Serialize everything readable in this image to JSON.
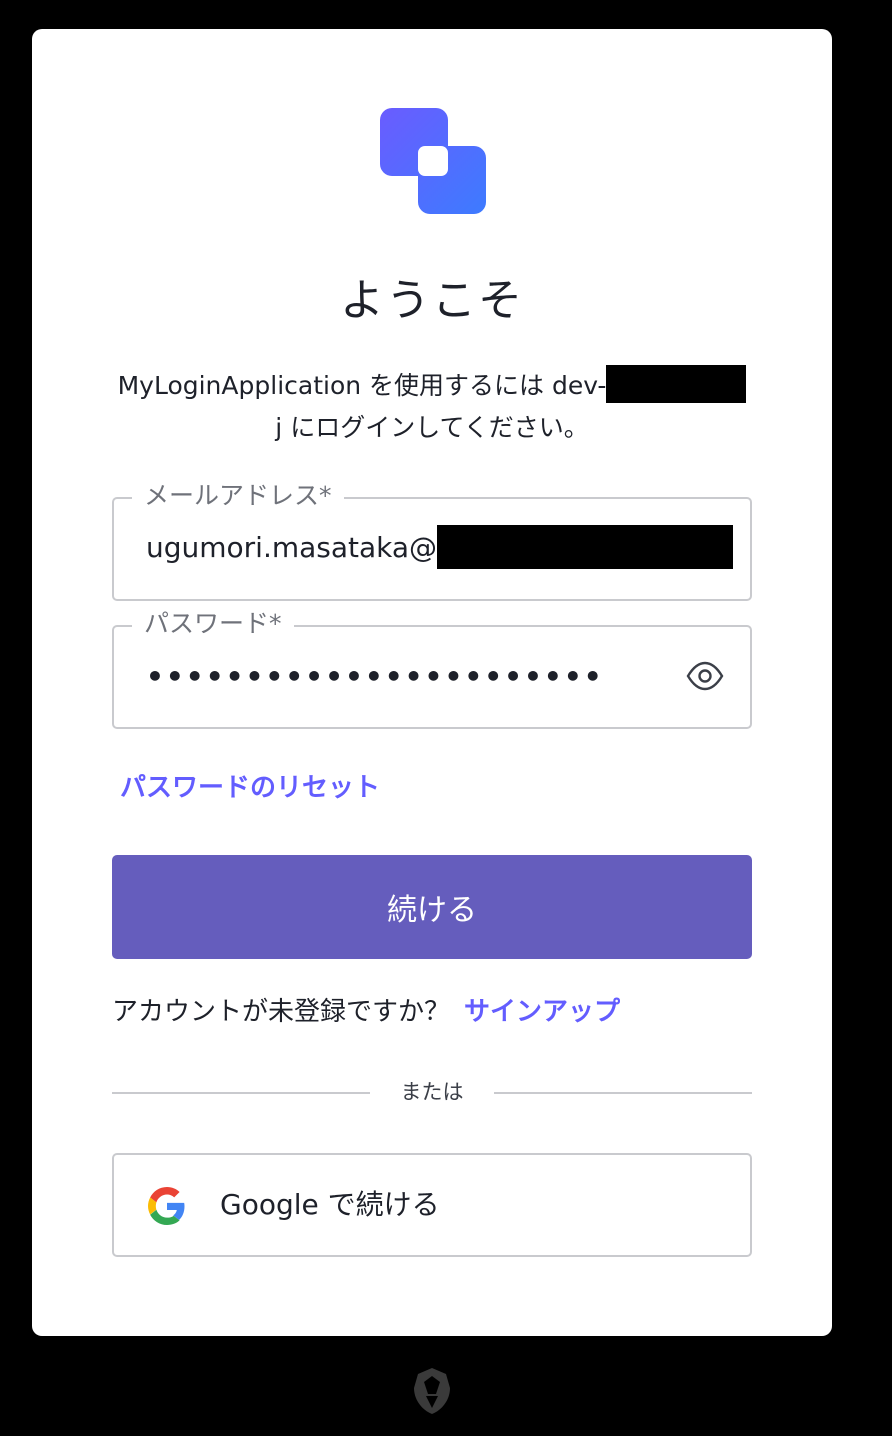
{
  "title": "ようこそ",
  "description": {
    "line1": "MyLoginApplication を使用するには dev-",
    "line2": "j にログインしてください。"
  },
  "email_field": {
    "label": "メールアドレス*",
    "value": "ugumori.masataka@"
  },
  "password_field": {
    "label": "パスワード*",
    "value": "•••••••••••••••••••••••"
  },
  "reset_link": "パスワードのリセット",
  "continue_button": "続ける",
  "signup": {
    "prompt": "アカウントが未登録ですか？",
    "link": "サインアップ"
  },
  "divider_text": "または",
  "google_button": "Google で続ける",
  "icons": {
    "logo": "app-logo-icon",
    "eye": "eye-icon",
    "google": "google-icon",
    "badge": "shield-badge-icon"
  },
  "colors": {
    "accent": "#635dff",
    "button": "#655dbd",
    "background": "#000000",
    "card": "#ffffff"
  }
}
